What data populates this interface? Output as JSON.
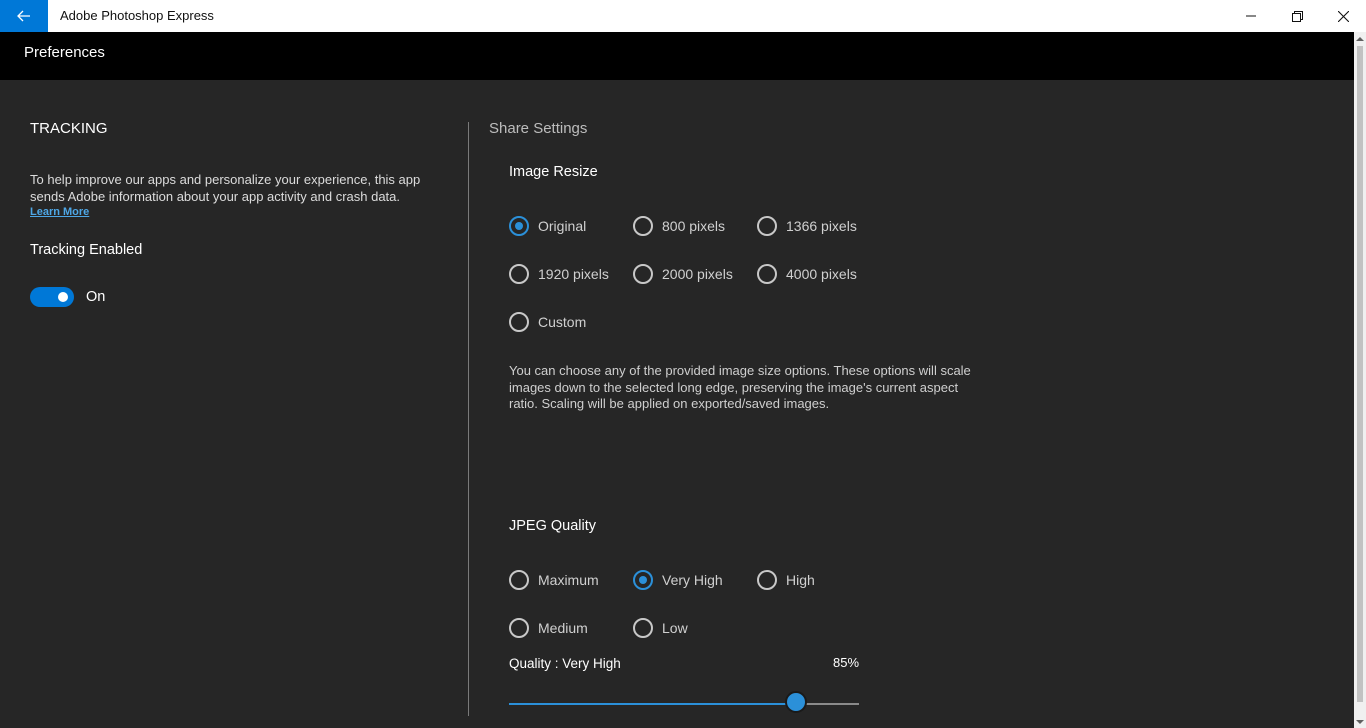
{
  "window": {
    "title": "Adobe Photoshop Express",
    "back_icon": "arrow-left-icon",
    "minimize_icon": "minimize-icon",
    "maximize_icon": "restore-icon",
    "close_icon": "close-icon"
  },
  "header": {
    "title": "Preferences"
  },
  "tracking": {
    "section_title": "TRACKING",
    "description": "To help improve our apps and personalize your experience, this app sends Adobe information about your app activity and crash data.",
    "learn_more": "Learn More",
    "toggle_label": "Tracking Enabled",
    "toggle_state": "On",
    "toggle_on": true
  },
  "share_settings": {
    "title": "Share Settings",
    "image_resize": {
      "title": "Image Resize",
      "options": [
        {
          "label": "Original",
          "checked": true
        },
        {
          "label": "800 pixels",
          "checked": false
        },
        {
          "label": "1366 pixels",
          "checked": false
        },
        {
          "label": "1920 pixels",
          "checked": false
        },
        {
          "label": "2000 pixels",
          "checked": false
        },
        {
          "label": "4000 pixels",
          "checked": false
        },
        {
          "label": "Custom",
          "checked": false
        }
      ],
      "description": "You can choose any of the provided image size options. These options will scale images down to the selected long edge, preserving the image's current aspect ratio. Scaling will be applied on exported/saved images."
    },
    "jpeg_quality": {
      "title": "JPEG Quality",
      "options": [
        {
          "label": "Maximum",
          "checked": false
        },
        {
          "label": "Very High",
          "checked": true
        },
        {
          "label": "High",
          "checked": false
        },
        {
          "label": "Medium",
          "checked": false
        },
        {
          "label": "Low",
          "checked": false
        }
      ],
      "quality_label": "Quality : Very High",
      "quality_value": "85%",
      "slider_fraction": 0.82
    }
  },
  "colors": {
    "accent": "#0078d7",
    "radio_accent": "#2b90d9",
    "background": "#262626",
    "header": "#000000"
  }
}
